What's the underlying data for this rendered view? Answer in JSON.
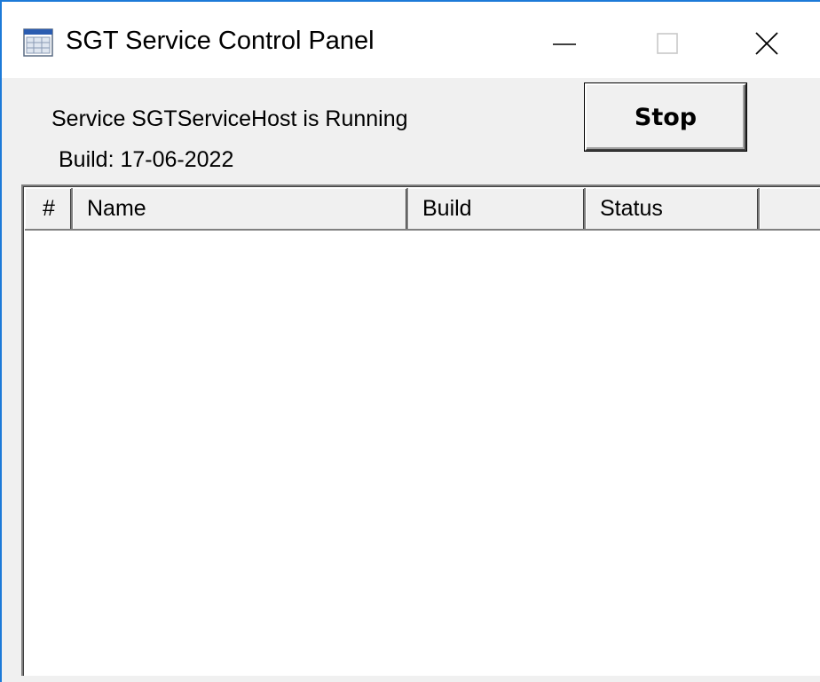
{
  "window": {
    "title": "SGT Service Control Panel",
    "accent_color": "#1c7ad8",
    "icon": "app-window-icon"
  },
  "controls": {
    "minimize_icon": "minimize-icon",
    "maximize_icon": "maximize-icon",
    "close_icon": "close-icon"
  },
  "service": {
    "status_text": "Service SGTServiceHost is Running",
    "build_text": "Build: 17-06-2022"
  },
  "toolbar": {
    "stop_label": "Stop"
  },
  "table": {
    "columns": [
      "#",
      "Name",
      "Build",
      "Status",
      ""
    ],
    "rows": []
  }
}
